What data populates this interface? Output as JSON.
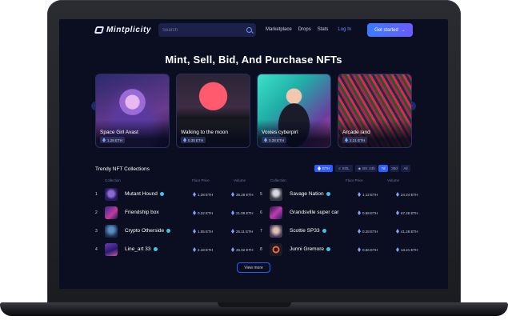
{
  "header": {
    "logo": "Mintplicity",
    "search_placeholder": "Search",
    "nav": [
      "Marketplace",
      "Drops",
      "Stats"
    ],
    "login": "Log In",
    "cta": "Get started"
  },
  "hero": {
    "title": "Mint, Sell, Bid, And Purchase NFTs",
    "cards": [
      {
        "name": "Space Girl Avast",
        "price": "1.28 ETH"
      },
      {
        "name": "Walking to the moon",
        "price": "0.35 ETH"
      },
      {
        "name": "Voxies cyberpirl",
        "price": "0.28 ETH"
      },
      {
        "name": "Arcade land",
        "price": "2.21 ETH"
      }
    ]
  },
  "trending": {
    "title": "Trendy NFT Collections",
    "chains": [
      "ETH",
      "SOL",
      "BSC"
    ],
    "periods": [
      "24h",
      "7d",
      "30d",
      "All"
    ],
    "columns": {
      "collection": "Collection",
      "floor": "Floor Price",
      "volume": "Volume"
    },
    "left": [
      {
        "rank": "1",
        "name": "Mutant Hound",
        "floor": "1.28 ETH",
        "volume": "35.28 ETH"
      },
      {
        "rank": "2",
        "name": "Friendship box",
        "floor": "0.22 ETH",
        "volume": "21.09 ETH"
      },
      {
        "rank": "3",
        "name": "Crypto Otherside",
        "floor": "1.05 ETH",
        "volume": "25.11 ETH"
      },
      {
        "rank": "4",
        "name": "Line_art 33",
        "floor": "2.18 ETH",
        "volume": "45.02 ETH"
      }
    ],
    "right": [
      {
        "rank": "5",
        "name": "Savage Nation",
        "floor": "1.12 ETH",
        "volume": "24.24 ETH"
      },
      {
        "rank": "6",
        "name": "Grandsville super car",
        "floor": "0.99 ETH",
        "volume": "67.28 ETH"
      },
      {
        "rank": "7",
        "name": "Scottie SP33",
        "floor": "0.28 ETH",
        "volume": "41.28 ETH"
      },
      {
        "rank": "8",
        "name": "Junni Gremore",
        "floor": "0.56 ETH",
        "volume": "13.21 ETH"
      }
    ],
    "view_more": "View more"
  },
  "colors": {
    "bg": "#0b0e21",
    "accent": "#2f5bff",
    "verified": "#37c8e6"
  }
}
